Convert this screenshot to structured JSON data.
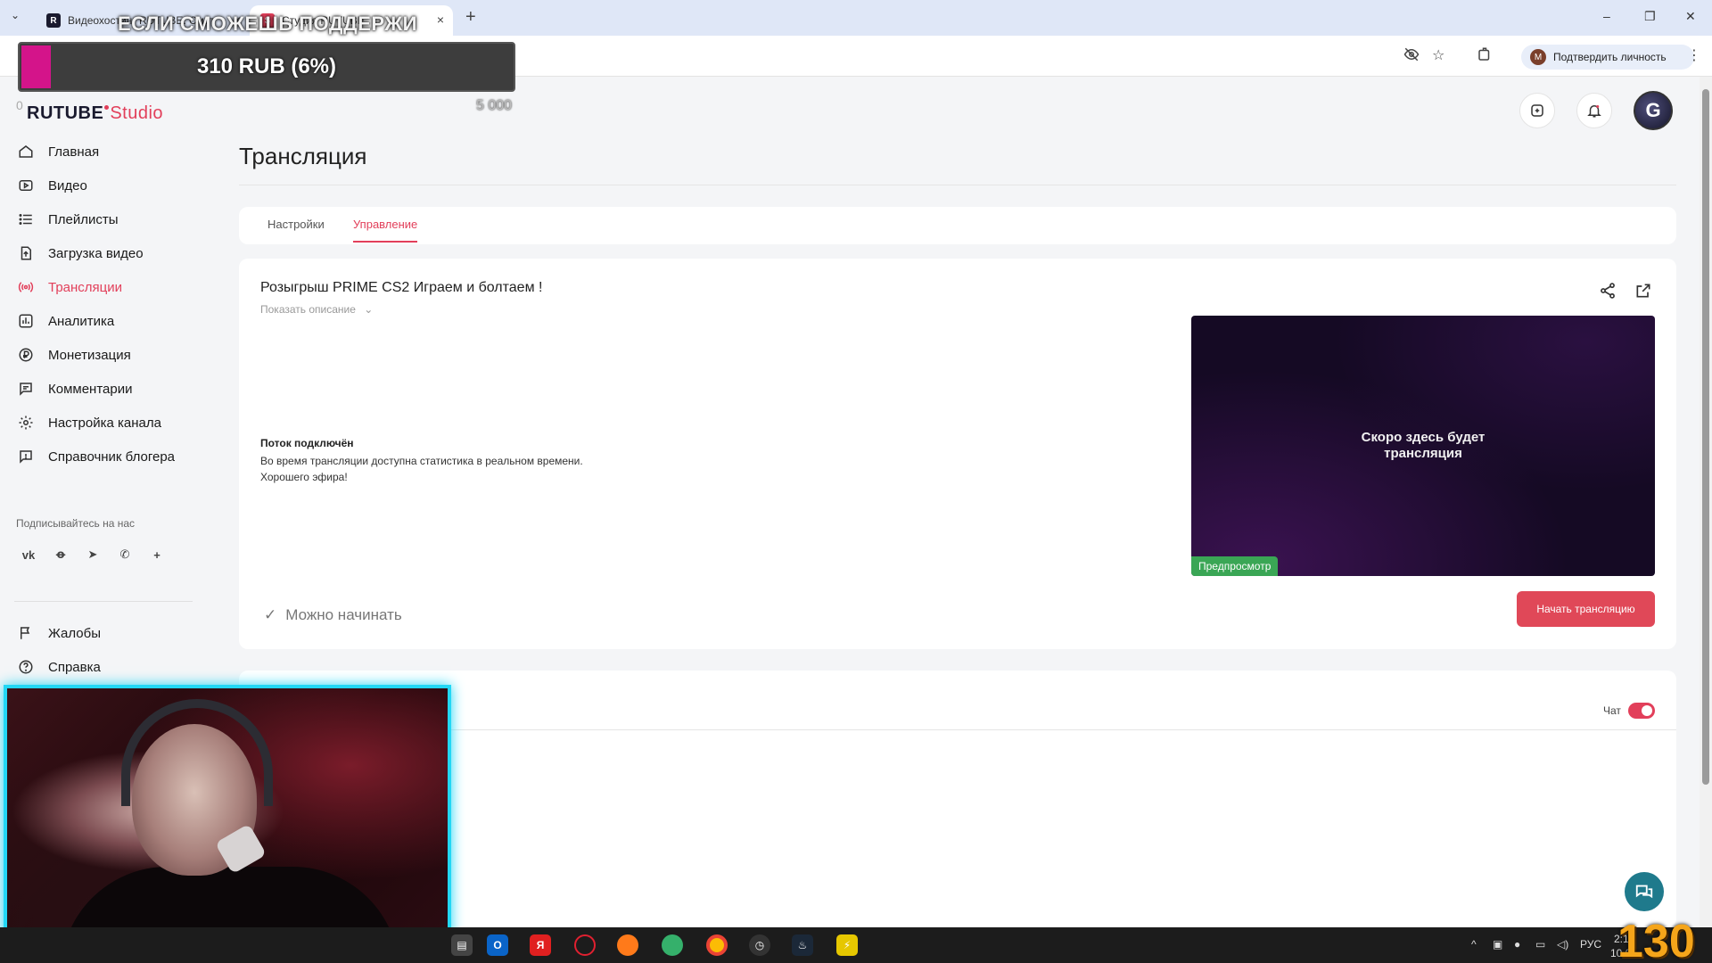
{
  "browser": {
    "tabs": [
      {
        "title": "Видеохостинг RUTUBE. Смот",
        "active": false
      },
      {
        "title": "Студия RUTUBE",
        "active": true
      }
    ],
    "verify_label": "Подтвердить личность",
    "verify_avatar_letter": "M"
  },
  "donation": {
    "headline": "ЕСЛИ СМОЖЕШЬ ПОДДЕРЖИ",
    "amount": "310 RUB (6%)",
    "progress_fraction": 0.06,
    "min": "0",
    "max": "5 000",
    "fill_color": "#d4148a"
  },
  "app": {
    "logo_main": "RUTUBE",
    "logo_suffix": "Studio",
    "accent_color": "#e23f5a",
    "avatar_letter": "G"
  },
  "sidebar": {
    "items": [
      {
        "label": "Главная",
        "icon": "home-icon"
      },
      {
        "label": "Видео",
        "icon": "video-icon"
      },
      {
        "label": "Плейлисты",
        "icon": "list-icon"
      },
      {
        "label": "Загрузка видео",
        "icon": "upload-icon"
      },
      {
        "label": "Трансляции",
        "icon": "broadcast-icon",
        "active": true
      },
      {
        "label": "Аналитика",
        "icon": "chart-icon"
      },
      {
        "label": "Монетизация",
        "icon": "ruble-icon"
      },
      {
        "label": "Комментарии",
        "icon": "comment-icon"
      },
      {
        "label": "Настройка канала",
        "icon": "gear-icon"
      },
      {
        "label": "Справочник блогера",
        "icon": "info-icon"
      }
    ],
    "subscribe_label": "Подписывайтесь на нас",
    "socials": [
      "vk",
      "ok",
      "telegram",
      "viber",
      "more"
    ],
    "bottom_items": [
      {
        "label": "Жалобы",
        "icon": "flag-icon"
      },
      {
        "label": "Справка",
        "icon": "help-icon"
      }
    ]
  },
  "main": {
    "title": "Трансляция",
    "tabs": [
      {
        "label": "Настройки",
        "active": false
      },
      {
        "label": "Управление",
        "active": true
      }
    ],
    "stream": {
      "title": "Розыгрыш PRIME CS2 Играем и болтаем !",
      "show_description": "Показать описание",
      "status_title": "Поток подключён",
      "status_line1": "Во время трансляции доступна статистика в реальном времени.",
      "status_line2": "Хорошего эфира!",
      "ready_label": "Можно начинать",
      "preview_line1": "Скоро здесь будет",
      "preview_line2": "трансляция",
      "preview_badge": "Предпросмотр",
      "start_button": "Начать трансляцию"
    },
    "chat": {
      "label": "Чат",
      "enabled": true
    }
  },
  "taskbar": {
    "lang": "РУС",
    "time": "2:16",
    "date": "10.0",
    "overlay_counter": "130"
  }
}
